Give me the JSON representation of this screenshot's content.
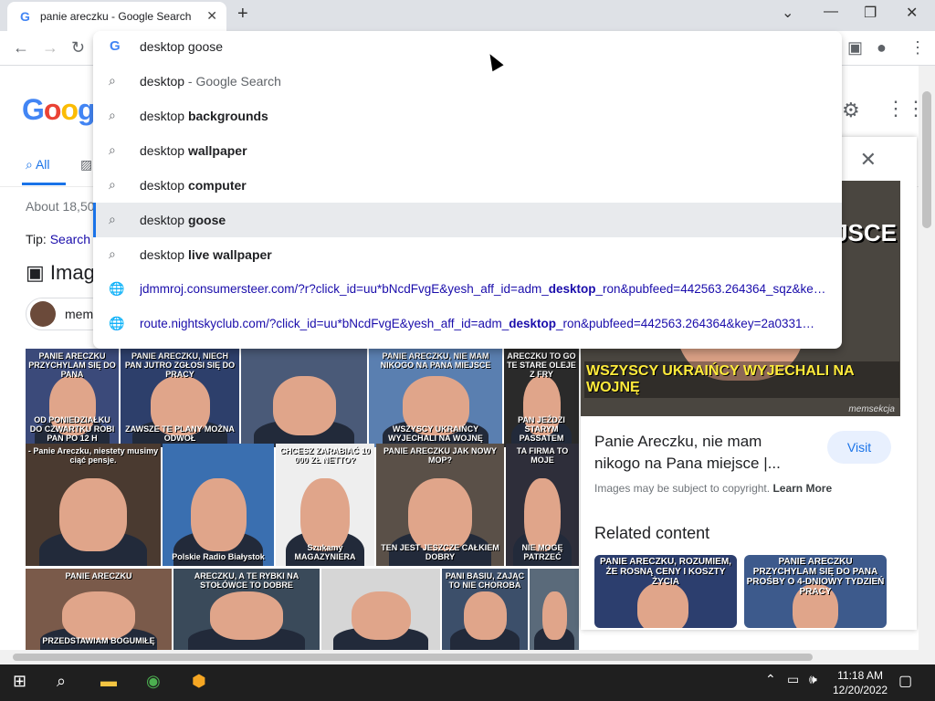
{
  "browser": {
    "tab_title": "panie areczku - Google Search",
    "tab_favicon": "G",
    "tab_close": "✕",
    "new_tab": "+",
    "controls": {
      "list": "⌄",
      "minimize": "—",
      "maximize": "❐",
      "close": "✕"
    }
  },
  "toolbar": {
    "back": "←",
    "forward": "→",
    "reload": "↻",
    "profile": "●",
    "menu": "⋮",
    "sidepanel": "▣"
  },
  "omnibox": {
    "icon": "G",
    "value": "desktop goose",
    "suggestions": [
      {
        "prefix": "desktop",
        "bold": "",
        "suffix": " - Google Search",
        "type": "search"
      },
      {
        "prefix": "desktop ",
        "bold": "backgrounds",
        "suffix": "",
        "type": "search"
      },
      {
        "prefix": "desktop ",
        "bold": "wallpaper",
        "suffix": "",
        "type": "search"
      },
      {
        "prefix": "desktop ",
        "bold": "computer",
        "suffix": "",
        "type": "search"
      },
      {
        "prefix": "desktop ",
        "bold": "goose",
        "suffix": "",
        "type": "search",
        "selected": true
      },
      {
        "prefix": "desktop ",
        "bold": "live wallpaper",
        "suffix": "",
        "type": "search"
      },
      {
        "prefix": "jdmmroj.consumersteer.com/?r?click_id=uu*bNcdFvgE&yesh_aff_id=adm_",
        "bold": "desktop",
        "suffix": "_ron&pubfeed=442563.264364_sqz&ke…",
        "type": "url"
      },
      {
        "prefix": "route.nightskyclub.com/?click_id=uu*bNcdFvgE&yesh_aff_id=adm_",
        "bold": "desktop",
        "suffix": "_ron&pubfeed=442563.264364&key=2a0331…",
        "type": "url"
      }
    ]
  },
  "page": {
    "logo": "Google",
    "tab_all": "All",
    "stats": "About 18,50",
    "tip_label": "Tip: ",
    "tip_link": "Search",
    "images_heading": "Imag",
    "chip_label": "mem"
  },
  "grid_captions": [
    {
      "top": "PANIE ARECZKU PRZYCHYLAM SIĘ DO PANA",
      "bottom": "OD PONIEDZIAŁKU DO CZWARTKU ROBI PAN PO 12 H"
    },
    {
      "top": "PANIE ARECZKU, NIECH PAN JUTRO ZGŁOSI SIĘ DO PRACY",
      "bottom": "ZAWSZE TE PLANY MOŻNA ODWOŁ"
    },
    {
      "top": "",
      "bottom": ""
    },
    {
      "top": "PANIE ARECZKU, NIE MAM NIKOGO NA PANA MIEJSCE",
      "bottom": "WSZYSCY UKRAIŃCY WYJECHALI NA WOJNĘ"
    },
    {
      "top": "ARECZKU TO GO TE STARE OLEJE Z FRY",
      "bottom": "PAN JEŹDZI STARYM PASSATEM"
    },
    {
      "top": "- Panie Areczku, niestety musimy ciąć pensje.",
      "bottom": ""
    },
    {
      "top": "",
      "bottom": "Polskie Radio Białystok"
    },
    {
      "top": "CHCESZ ZARABIAĆ 10 000 ZŁ NETTO?",
      "bottom": "Szukamy MAGAZYNIERA"
    },
    {
      "top": "PANIE ARECZKU JAK NOWY MOP?",
      "bottom": "TEN JEST JESZCZE CAŁKIEM DOBRY"
    },
    {
      "top": "TA FIRMA TO MOJE",
      "bottom": "NIE MOGĘ PATRZEĆ"
    },
    {
      "top": "PANIE ARECZKU",
      "bottom": "PRZEDSTAWIAM BOGUMIŁĘ"
    },
    {
      "top": "ARECZKU, A TE RYBKI NA STOŁÓWCE TO DOBRE",
      "bottom": ""
    },
    {
      "top": "",
      "bottom": ""
    },
    {
      "top": "PANI BASIU, ZAJĄC TO NIE CHOROBA",
      "bottom": ""
    },
    {
      "top": "",
      "bottom": ""
    }
  ],
  "panel": {
    "close": "✕",
    "image_top_text": "JEJSCE",
    "image_bottom_text": "WSZYSCY UKRAIŃCY WYJECHALI NA WOJNĘ",
    "watermark": "memsekcja",
    "title": "Panie Areczku, nie mam nikogo na Pana miejsce |...",
    "visit": "Visit",
    "copyright_text": "Images may be subject to copyright.",
    "learn_more": "Learn More",
    "related_heading": "Related content",
    "related": [
      {
        "caption": "PANIE ARECZKU, ROZUMIEM, ŻE ROSNĄ CENY I KOSZTY ŻYCIA"
      },
      {
        "caption": "PANIE ARECZKU PRZYCHYLAM SIĘ DO PANA PROŚBY O 4-DNIOWY TYDZIEŃ PRACY"
      }
    ]
  },
  "taskbar": {
    "time": "11:18 AM",
    "date": "12/20/2022",
    "start": "⊞",
    "search": "⌕"
  },
  "colors": {
    "accent": "#1a73e8",
    "link": "#1a0dab",
    "taskbar": "#1f1f1f"
  }
}
